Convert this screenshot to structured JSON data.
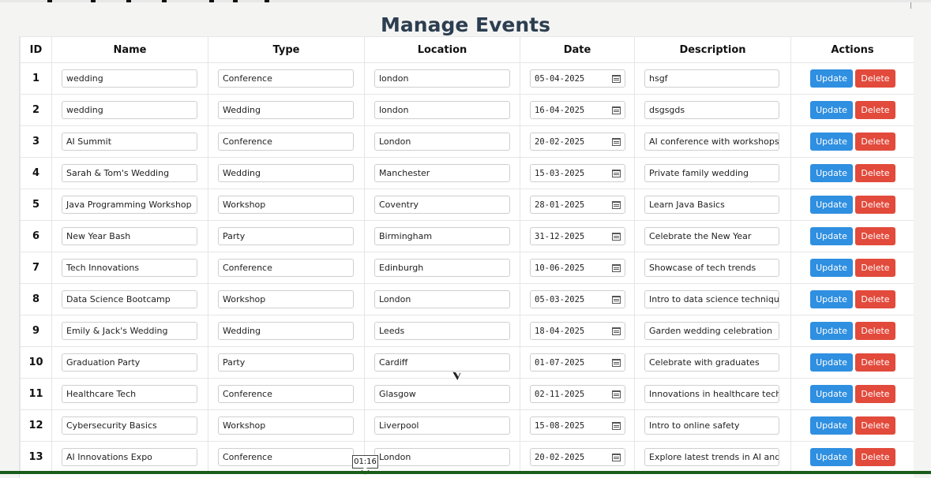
{
  "page": {
    "title": "Manage Events"
  },
  "table": {
    "headers": [
      "ID",
      "Name",
      "Type",
      "Location",
      "Date",
      "Description",
      "Actions"
    ],
    "actions": {
      "update_label": "Update",
      "delete_label": "Delete"
    },
    "rows": [
      {
        "id": "1",
        "name": "wedding",
        "type": "Conference",
        "location": "london",
        "date": "05-04-2025",
        "description": "hsgf"
      },
      {
        "id": "2",
        "name": "wedding",
        "type": "Wedding",
        "location": "london",
        "date": "16-04-2025",
        "description": "dsgsgds"
      },
      {
        "id": "3",
        "name": "AI Summit",
        "type": "Conference",
        "location": "London",
        "date": "20-02-2025",
        "description": "AI conference with workshops"
      },
      {
        "id": "4",
        "name": "Sarah & Tom's Wedding",
        "type": "Wedding",
        "location": "Manchester",
        "date": "15-03-2025",
        "description": "Private family wedding"
      },
      {
        "id": "5",
        "name": "Java Programming Workshop",
        "type": "Workshop",
        "location": "Coventry",
        "date": "28-01-2025",
        "description": "Learn Java Basics"
      },
      {
        "id": "6",
        "name": "New Year Bash",
        "type": "Party",
        "location": "Birmingham",
        "date": "31-12-2025",
        "description": "Celebrate the New Year"
      },
      {
        "id": "7",
        "name": "Tech Innovations",
        "type": "Conference",
        "location": "Edinburgh",
        "date": "10-06-2025",
        "description": "Showcase of tech trends"
      },
      {
        "id": "8",
        "name": "Data Science Bootcamp",
        "type": "Workshop",
        "location": "London",
        "date": "05-03-2025",
        "description": "Intro to data science techniques"
      },
      {
        "id": "9",
        "name": "Emily & Jack's Wedding",
        "type": "Wedding",
        "location": "Leeds",
        "date": "18-04-2025",
        "description": "Garden wedding celebration"
      },
      {
        "id": "10",
        "name": "Graduation Party",
        "type": "Party",
        "location": "Cardiff",
        "date": "01-07-2025",
        "description": "Celebrate with graduates"
      },
      {
        "id": "11",
        "name": "Healthcare Tech",
        "type": "Conference",
        "location": "Glasgow",
        "date": "02-11-2025",
        "description": "Innovations in healthcare tech"
      },
      {
        "id": "12",
        "name": "Cybersecurity Basics",
        "type": "Workshop",
        "location": "Liverpool",
        "date": "15-08-2025",
        "description": "Intro to online safety"
      },
      {
        "id": "13",
        "name": "AI Innovations Expo",
        "type": "Conference",
        "location": "London",
        "date": "20-02-2025",
        "description": "Explore latest trends in AI and ML."
      }
    ]
  },
  "tooltip": {
    "text": "01:16"
  },
  "icons": {
    "date_field": "calendar-icon",
    "cursor": "mouse-pointer-icon"
  },
  "colors": {
    "update_button": "#2f8fe0",
    "delete_button": "#e24a3b",
    "title": "#2c3e50"
  }
}
